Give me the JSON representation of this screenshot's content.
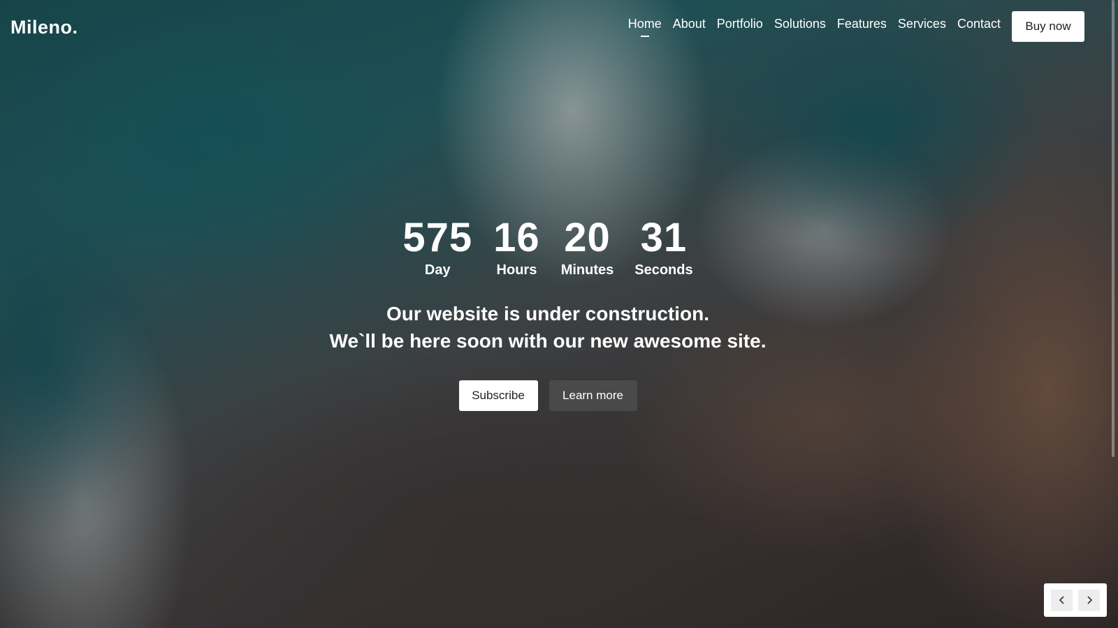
{
  "brand": {
    "logo": "Mileno."
  },
  "nav": {
    "items": [
      {
        "label": "Home",
        "active": true
      },
      {
        "label": "About"
      },
      {
        "label": "Portfolio"
      },
      {
        "label": "Solutions"
      },
      {
        "label": "Features"
      },
      {
        "label": "Services"
      },
      {
        "label": "Contact"
      }
    ],
    "cta_label": "Buy now"
  },
  "countdown": {
    "units": [
      {
        "value": "575",
        "label": "Day"
      },
      {
        "value": "16",
        "label": "Hours"
      },
      {
        "value": "20",
        "label": "Minutes"
      },
      {
        "value": "31",
        "label": "Seconds"
      }
    ]
  },
  "message": {
    "line1": "Our website is under construction.",
    "line2": "We`ll be here soon with our new awesome site."
  },
  "buttons": {
    "subscribe": "Subscribe",
    "learn_more": "Learn more"
  },
  "slider": {
    "prev_icon": "chevron-left-icon",
    "next_icon": "chevron-right-icon"
  },
  "colors": {
    "button_bg": "#ffffff",
    "button_text": "#222222"
  }
}
